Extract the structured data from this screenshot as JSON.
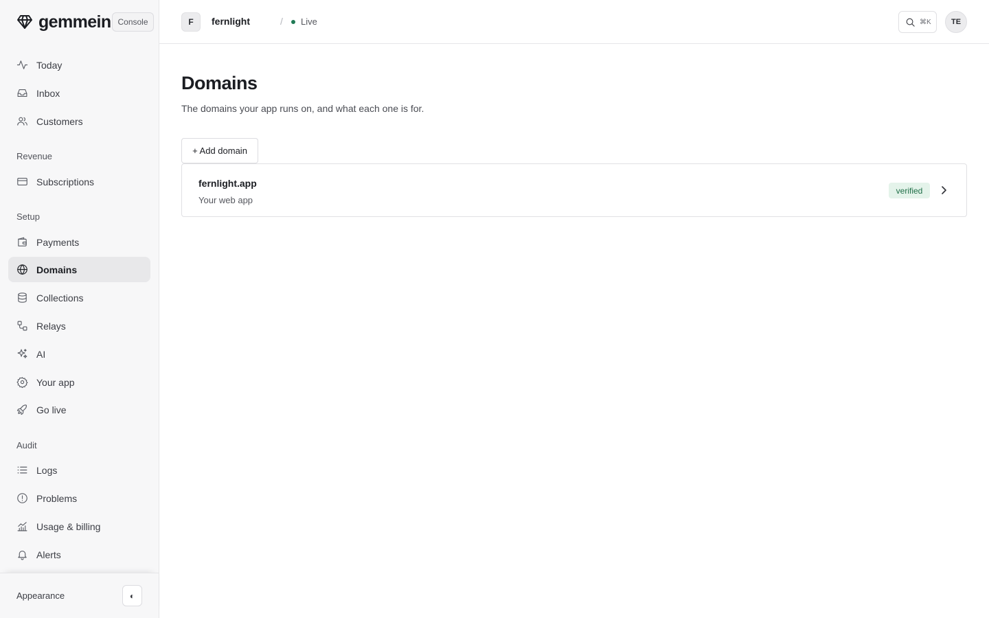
{
  "brand": {
    "name": "gemmein",
    "badge": "Console"
  },
  "sidebar": {
    "primary": [
      {
        "label": "Today",
        "icon": "activity-icon"
      },
      {
        "label": "Inbox",
        "icon": "inbox-icon"
      },
      {
        "label": "Customers",
        "icon": "users-icon"
      }
    ],
    "sections": [
      {
        "label": "Revenue",
        "items": [
          {
            "label": "Subscriptions",
            "icon": "credit-card-icon"
          }
        ]
      },
      {
        "label": "Setup",
        "items": [
          {
            "label": "Payments",
            "icon": "wallet-icon"
          },
          {
            "label": "Domains",
            "icon": "globe-icon",
            "active": true
          },
          {
            "label": "Collections",
            "icon": "database-icon"
          },
          {
            "label": "Relays",
            "icon": "relay-icon"
          },
          {
            "label": "AI",
            "icon": "sparkles-icon"
          },
          {
            "label": "Your app",
            "icon": "gear-icon"
          },
          {
            "label": "Go live",
            "icon": "rocket-icon"
          }
        ]
      },
      {
        "label": "Audit",
        "items": [
          {
            "label": "Logs",
            "icon": "list-icon"
          },
          {
            "label": "Problems",
            "icon": "alert-circle-icon"
          },
          {
            "label": "Usage & billing",
            "icon": "chart-icon"
          },
          {
            "label": "Alerts",
            "icon": "bell-icon"
          }
        ]
      }
    ],
    "footer": {
      "label": "Appearance",
      "toggle_glyph": "◐"
    }
  },
  "topbar": {
    "project_initial": "F",
    "project_name": "fernlight",
    "separator": "/",
    "status": "Live",
    "search_shortcut": "⌘K",
    "user_initials": "TE"
  },
  "main": {
    "title": "Domains",
    "subtitle": "The domains your app runs on, and what each one is for.",
    "add_button": "+ Add domain",
    "domains": [
      {
        "name": "fernlight.app",
        "description": "Your web app",
        "status": "verified"
      }
    ]
  },
  "colors": {
    "status_live": "#1f7a55",
    "verified_bg": "#e4f3ea",
    "verified_text": "#1f6e47",
    "active_nav_bg": "#e8e8ea"
  }
}
